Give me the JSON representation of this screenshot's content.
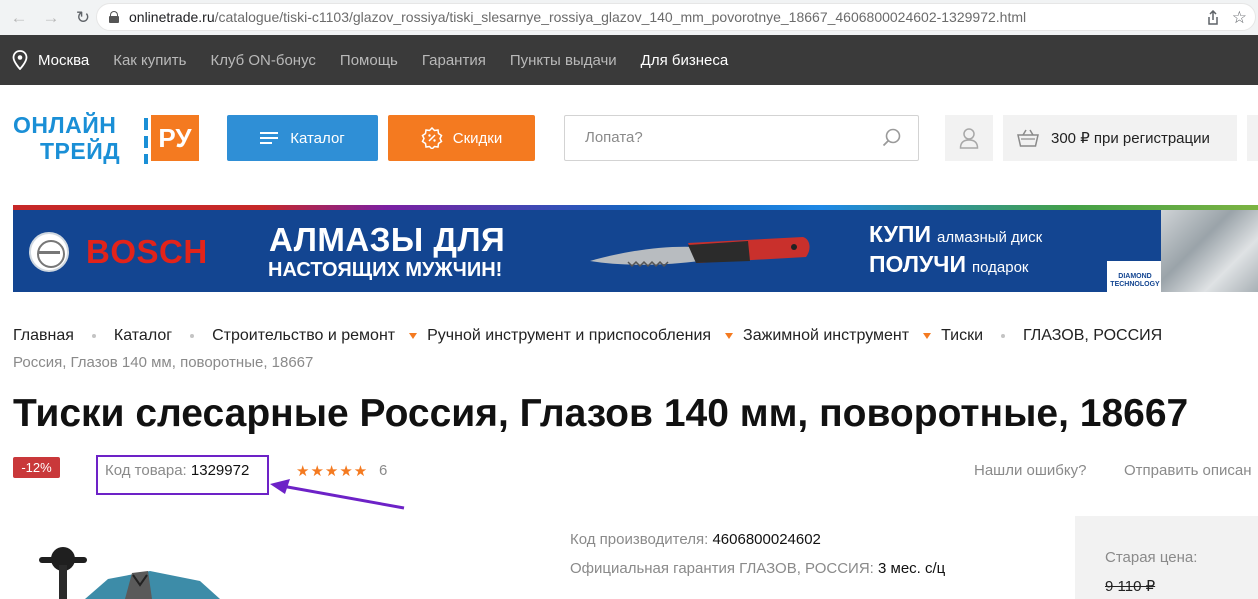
{
  "browser": {
    "url_host": "onlinetrade.ru",
    "url_path": "/catalogue/tiski-c1103/glazov_rossiya/tiski_slesarnye_rossiya_glazov_140_mm_povorotnye_18667_4606800024602-1329972.html"
  },
  "topnav": {
    "city": "Москва",
    "items": [
      "Как купить",
      "Клуб ON-бонус",
      "Помощь",
      "Гарантия",
      "Пункты выдачи"
    ],
    "business": "Для бизнеса"
  },
  "header": {
    "logo_line1": "ОНЛАЙН",
    "logo_line2": "ТРЕЙД",
    "logo_ru": "РУ",
    "catalog_label": "Каталог",
    "discounts_label": "Скидки",
    "search_placeholder": "Лопата?",
    "cart_label": "300 ₽ при регистрации"
  },
  "banner": {
    "brand": "BOSCH",
    "headline1": "АЛМАЗЫ ДЛЯ",
    "headline2": "НАСТОЯЩИХ МУЖЧИН!",
    "buy_big": "КУПИ",
    "buy_small": "алмазный диск",
    "get_big": "ПОЛУЧИ",
    "get_small": "подарок",
    "diamond_label": "DIAMOND TECHNOLOGY"
  },
  "breadcrumbs": {
    "items": [
      "Главная",
      "Каталог",
      "Строительство и ремонт",
      "Ручной инструмент и приспособления",
      "Зажимной инструмент",
      "Тиски",
      "ГЛАЗОВ, РОССИЯ"
    ],
    "current": "Россия, Глазов 140 мм, поворотные, 18667"
  },
  "product": {
    "title": "Тиски слесарные Россия, Глазов 140 мм, поворотные, 18667",
    "discount": "-12%",
    "sku_label": "Код товара:",
    "sku_value": "1329972",
    "stars": "★★★★★",
    "reviews_count": "6",
    "found_error": "Нашли ошибку?",
    "send_description": "Отправить описан",
    "mfr_code_label": "Код производителя:",
    "mfr_code_value": "4606800024602",
    "warranty_label": "Официальная гарантия ГЛАЗОВ, РОССИЯ:",
    "warranty_value": "3 мес. с/ц",
    "old_price_label": "Старая цена:",
    "old_price_value": "9 110 ₽"
  },
  "colors": {
    "brand_blue": "#2f8fd6",
    "brand_orange": "#f47a20",
    "highlight_purple": "#6d22c7",
    "discount_red": "#c9383a"
  }
}
